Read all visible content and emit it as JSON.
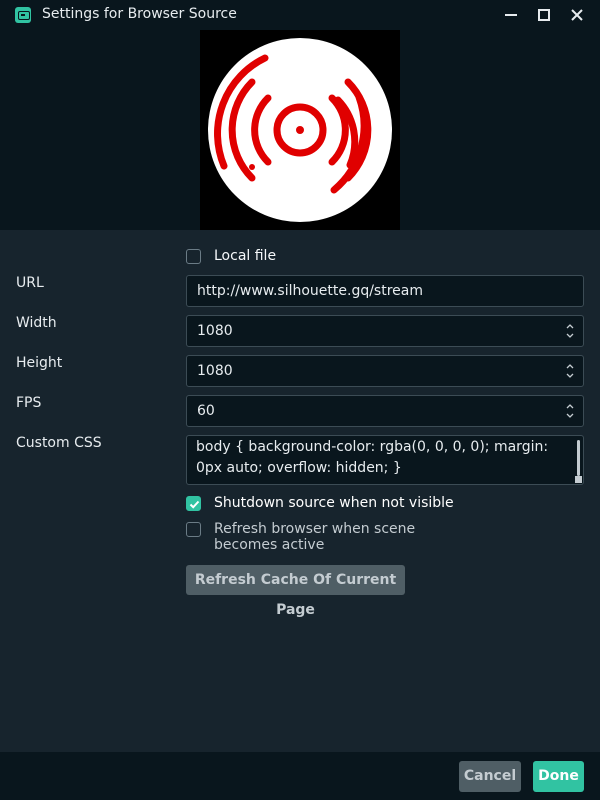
{
  "window": {
    "title": "Settings for Browser Source",
    "app_icon": "streamlabs-icon",
    "controls": [
      "minimize-icon",
      "maximize-icon",
      "close-icon"
    ]
  },
  "preview": {
    "image": "radio-broadcast-logo",
    "colors": {
      "background": "#000000",
      "circle": "#ffffff",
      "rings": "#e00000"
    }
  },
  "form": {
    "local_file": {
      "label": "Local file",
      "checked": false
    },
    "url": {
      "label": "URL",
      "value": "http://www.silhouette.gq/stream"
    },
    "width": {
      "label": "Width",
      "value": "1080"
    },
    "height": {
      "label": "Height",
      "value": "1080"
    },
    "fps": {
      "label": "FPS",
      "value": "60"
    },
    "custom_css": {
      "label": "Custom CSS",
      "value": "body { background-color: rgba(0, 0, 0, 0); margin: 0px auto; overflow: hidden; }"
    },
    "shutdown": {
      "label": "Shutdown source when not visible",
      "checked": true
    },
    "refresh_on_active": {
      "label": "Refresh browser when scene becomes active",
      "checked": false
    },
    "refresh_cache_button": "Refresh Cache Of Current Page"
  },
  "footer": {
    "cancel_label": "Cancel",
    "done_label": "Done"
  },
  "colors": {
    "accent": "#31c3a2",
    "background": "#17242d",
    "panel": "#09161d",
    "button_secondary": "#4f5e65"
  }
}
